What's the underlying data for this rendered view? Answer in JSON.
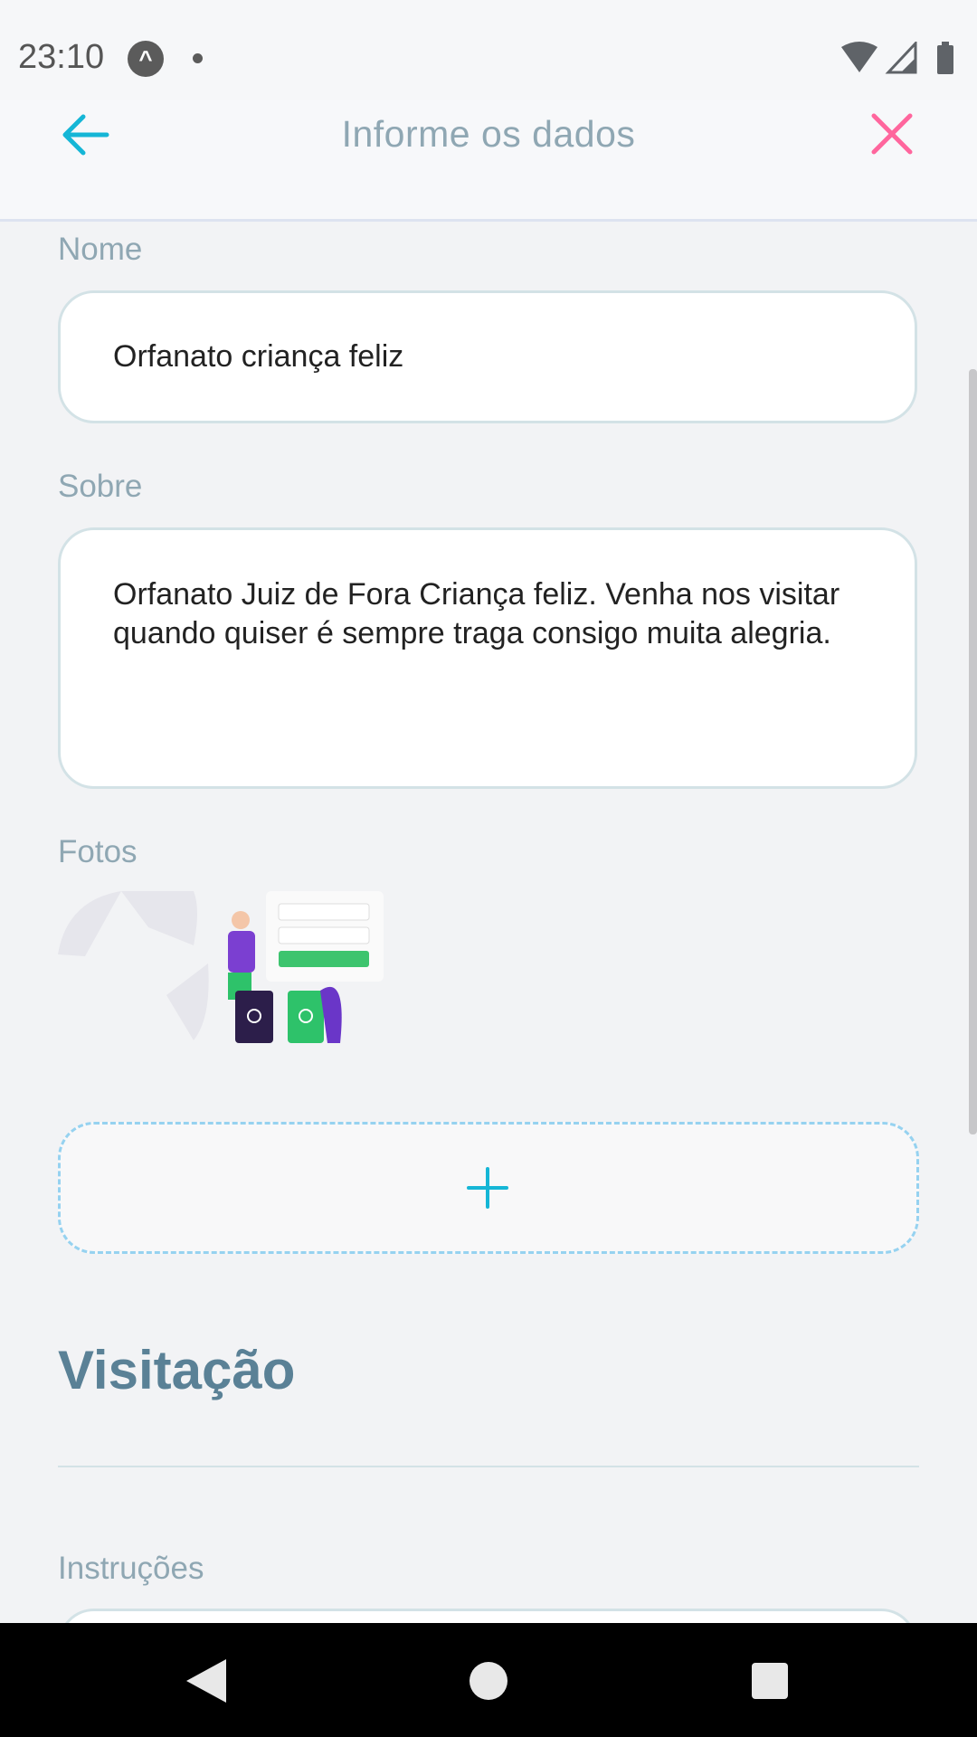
{
  "status_bar": {
    "time": "23:10",
    "app_icon_glyph": "^",
    "icons": [
      "wifi-icon",
      "signal-icon",
      "battery-icon"
    ]
  },
  "header": {
    "title": "Informe os dados",
    "back_icon": "arrow-left-icon",
    "close_icon": "close-icon"
  },
  "form": {
    "name_label": "Nome",
    "name_value": "Orfanato criança feliz",
    "about_label": "Sobre",
    "about_value": "Orfanato Juiz de Fora Criança feliz. Venha nos visitar quando quiser é sempre traga consigo muita alegria.",
    "photos_label": "Fotos",
    "add_photo_icon": "plus-icon",
    "visitation_title": "Visitação",
    "instructions_label": "Instruções"
  },
  "colors": {
    "accent": "#15b6d6",
    "close": "#ff669d",
    "label": "#8fa7b3",
    "section_title": "#5a8196",
    "dashed_border": "#96d2f0"
  }
}
